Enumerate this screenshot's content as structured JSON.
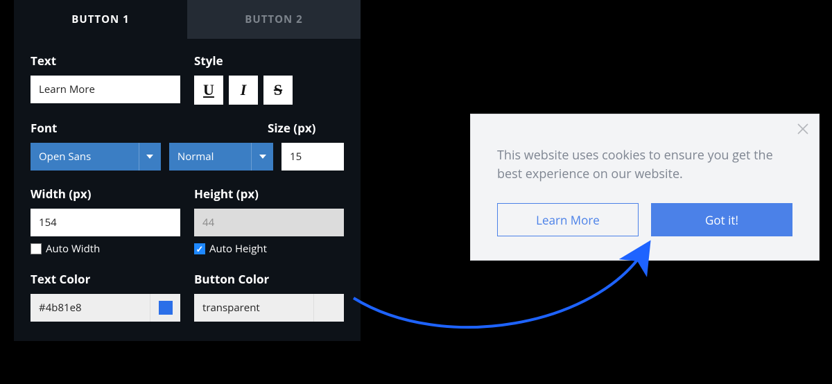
{
  "tabs": {
    "button1": "BUTTON 1",
    "button2": "BUTTON 2"
  },
  "labels": {
    "text": "Text",
    "style": "Style",
    "font": "Font",
    "size": "Size (px)",
    "width": "Width (px)",
    "height": "Height (px)",
    "autoWidth": "Auto Width",
    "autoHeight": "Auto Height",
    "textColor": "Text Color",
    "buttonColor": "Button Color"
  },
  "values": {
    "text": "Learn More",
    "font": "Open Sans",
    "weight": "Normal",
    "size": "15",
    "width": "154",
    "height": "44",
    "autoWidth": false,
    "autoHeight": true,
    "textColor": "#4b81e8",
    "buttonColor": "transparent"
  },
  "style_buttons": {
    "underline": "U",
    "italic": "I",
    "strike": "S"
  },
  "modal": {
    "message": "This website uses cookies to ensure you get the best experience on our website.",
    "learnMore": "Learn More",
    "gotIt": "Got it!"
  },
  "colors": {
    "accent": "#4b81e8",
    "selectBg": "#3b7ec4"
  }
}
